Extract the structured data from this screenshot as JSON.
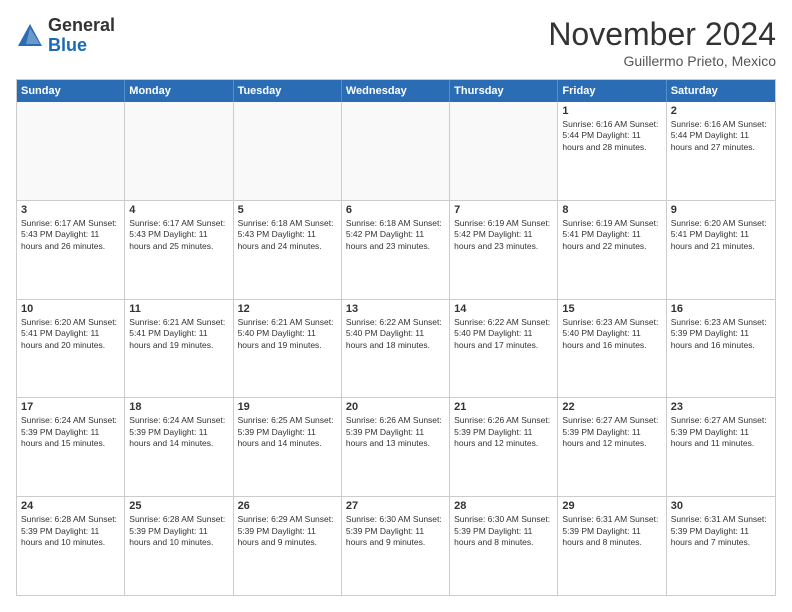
{
  "logo": {
    "general": "General",
    "blue": "Blue"
  },
  "title": "November 2024",
  "subtitle": "Guillermo Prieto, Mexico",
  "days_of_week": [
    "Sunday",
    "Monday",
    "Tuesday",
    "Wednesday",
    "Thursday",
    "Friday",
    "Saturday"
  ],
  "weeks": [
    [
      {
        "day": "",
        "info": "",
        "empty": true
      },
      {
        "day": "",
        "info": "",
        "empty": true
      },
      {
        "day": "",
        "info": "",
        "empty": true
      },
      {
        "day": "",
        "info": "",
        "empty": true
      },
      {
        "day": "",
        "info": "",
        "empty": true
      },
      {
        "day": "1",
        "info": "Sunrise: 6:16 AM\nSunset: 5:44 PM\nDaylight: 11 hours and 28 minutes."
      },
      {
        "day": "2",
        "info": "Sunrise: 6:16 AM\nSunset: 5:44 PM\nDaylight: 11 hours and 27 minutes."
      }
    ],
    [
      {
        "day": "3",
        "info": "Sunrise: 6:17 AM\nSunset: 5:43 PM\nDaylight: 11 hours and 26 minutes."
      },
      {
        "day": "4",
        "info": "Sunrise: 6:17 AM\nSunset: 5:43 PM\nDaylight: 11 hours and 25 minutes."
      },
      {
        "day": "5",
        "info": "Sunrise: 6:18 AM\nSunset: 5:43 PM\nDaylight: 11 hours and 24 minutes."
      },
      {
        "day": "6",
        "info": "Sunrise: 6:18 AM\nSunset: 5:42 PM\nDaylight: 11 hours and 23 minutes."
      },
      {
        "day": "7",
        "info": "Sunrise: 6:19 AM\nSunset: 5:42 PM\nDaylight: 11 hours and 23 minutes."
      },
      {
        "day": "8",
        "info": "Sunrise: 6:19 AM\nSunset: 5:41 PM\nDaylight: 11 hours and 22 minutes."
      },
      {
        "day": "9",
        "info": "Sunrise: 6:20 AM\nSunset: 5:41 PM\nDaylight: 11 hours and 21 minutes."
      }
    ],
    [
      {
        "day": "10",
        "info": "Sunrise: 6:20 AM\nSunset: 5:41 PM\nDaylight: 11 hours and 20 minutes."
      },
      {
        "day": "11",
        "info": "Sunrise: 6:21 AM\nSunset: 5:41 PM\nDaylight: 11 hours and 19 minutes."
      },
      {
        "day": "12",
        "info": "Sunrise: 6:21 AM\nSunset: 5:40 PM\nDaylight: 11 hours and 19 minutes."
      },
      {
        "day": "13",
        "info": "Sunrise: 6:22 AM\nSunset: 5:40 PM\nDaylight: 11 hours and 18 minutes."
      },
      {
        "day": "14",
        "info": "Sunrise: 6:22 AM\nSunset: 5:40 PM\nDaylight: 11 hours and 17 minutes."
      },
      {
        "day": "15",
        "info": "Sunrise: 6:23 AM\nSunset: 5:40 PM\nDaylight: 11 hours and 16 minutes."
      },
      {
        "day": "16",
        "info": "Sunrise: 6:23 AM\nSunset: 5:39 PM\nDaylight: 11 hours and 16 minutes."
      }
    ],
    [
      {
        "day": "17",
        "info": "Sunrise: 6:24 AM\nSunset: 5:39 PM\nDaylight: 11 hours and 15 minutes."
      },
      {
        "day": "18",
        "info": "Sunrise: 6:24 AM\nSunset: 5:39 PM\nDaylight: 11 hours and 14 minutes."
      },
      {
        "day": "19",
        "info": "Sunrise: 6:25 AM\nSunset: 5:39 PM\nDaylight: 11 hours and 14 minutes."
      },
      {
        "day": "20",
        "info": "Sunrise: 6:26 AM\nSunset: 5:39 PM\nDaylight: 11 hours and 13 minutes."
      },
      {
        "day": "21",
        "info": "Sunrise: 6:26 AM\nSunset: 5:39 PM\nDaylight: 11 hours and 12 minutes."
      },
      {
        "day": "22",
        "info": "Sunrise: 6:27 AM\nSunset: 5:39 PM\nDaylight: 11 hours and 12 minutes."
      },
      {
        "day": "23",
        "info": "Sunrise: 6:27 AM\nSunset: 5:39 PM\nDaylight: 11 hours and 11 minutes."
      }
    ],
    [
      {
        "day": "24",
        "info": "Sunrise: 6:28 AM\nSunset: 5:39 PM\nDaylight: 11 hours and 10 minutes."
      },
      {
        "day": "25",
        "info": "Sunrise: 6:28 AM\nSunset: 5:39 PM\nDaylight: 11 hours and 10 minutes."
      },
      {
        "day": "26",
        "info": "Sunrise: 6:29 AM\nSunset: 5:39 PM\nDaylight: 11 hours and 9 minutes."
      },
      {
        "day": "27",
        "info": "Sunrise: 6:30 AM\nSunset: 5:39 PM\nDaylight: 11 hours and 9 minutes."
      },
      {
        "day": "28",
        "info": "Sunrise: 6:30 AM\nSunset: 5:39 PM\nDaylight: 11 hours and 8 minutes."
      },
      {
        "day": "29",
        "info": "Sunrise: 6:31 AM\nSunset: 5:39 PM\nDaylight: 11 hours and 8 minutes."
      },
      {
        "day": "30",
        "info": "Sunrise: 6:31 AM\nSunset: 5:39 PM\nDaylight: 11 hours and 7 minutes."
      }
    ]
  ]
}
